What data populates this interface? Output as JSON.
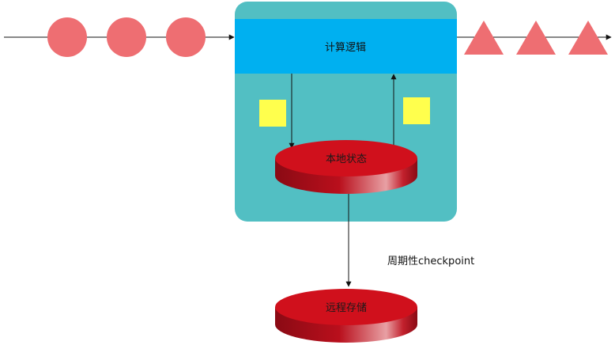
{
  "nodes": {
    "compute": {
      "label": "计算逻辑"
    },
    "local_state": {
      "label": "本地状态"
    },
    "remote_storage": {
      "label": "远程存储"
    }
  },
  "edges": {
    "checkpoint": {
      "label": "周期性checkpoint"
    }
  },
  "input_events": {
    "shape": "circle",
    "count": 3
  },
  "output_events": {
    "shape": "triangle",
    "count": 3
  },
  "state_markers": {
    "shape": "square",
    "count": 2
  },
  "colors": {
    "container": "#52bfc3",
    "compute_band": "#00b0f0",
    "event": "#ee6e72",
    "state_marker": "#ffff4d",
    "cylinder_top": "#d0101c",
    "cylinder_side_dark": "#8a0a14",
    "cylinder_side_light": "#e8a0a4"
  }
}
